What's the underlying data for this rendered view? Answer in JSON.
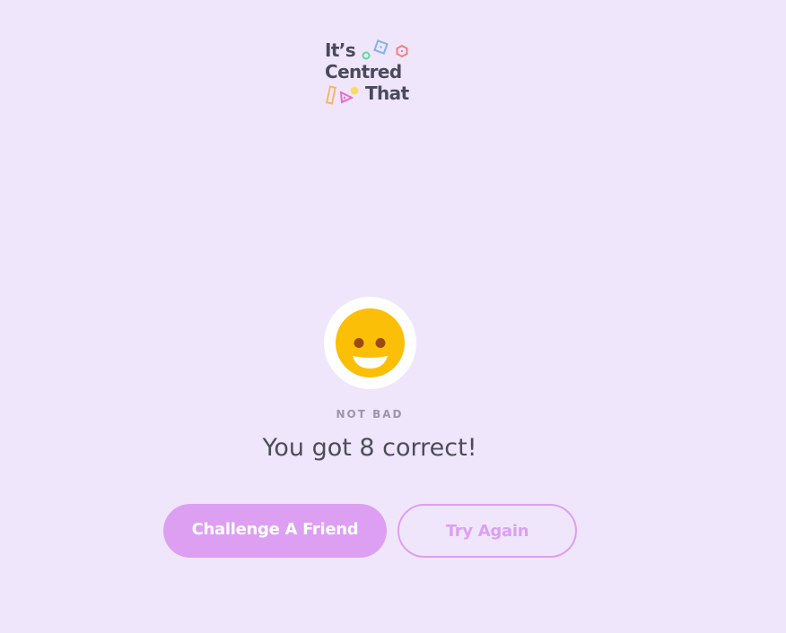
{
  "logo": {
    "line1": "It’s",
    "line2": "Centred",
    "line3": "That"
  },
  "result": {
    "emoji_icon": "smiling-face-icon",
    "label": "NOT BAD",
    "score_text": "You got 8 correct!"
  },
  "buttons": {
    "challenge_label": "Challenge A Friend",
    "try_again_label": "Try Again"
  },
  "colors": {
    "background": "#f0e6fc",
    "accent": "#dc9ff2",
    "emoji_face": "#fcbf07",
    "emoji_eyes": "#9a4a10",
    "logo_text": "#4a4a5a"
  }
}
